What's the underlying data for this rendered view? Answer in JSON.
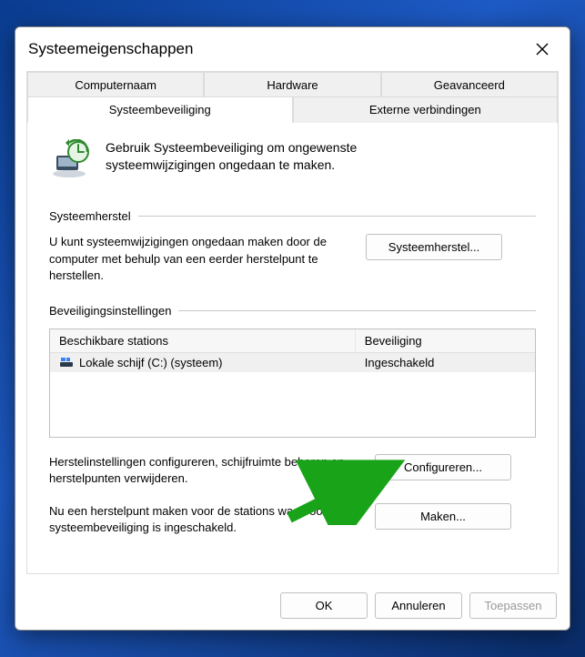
{
  "window": {
    "title": "Systeemeigenschappen"
  },
  "tabs": {
    "row1": {
      "computer_name": "Computernaam",
      "hardware": "Hardware",
      "advanced": "Geavanceerd"
    },
    "row2": {
      "system_protection": "Systeembeveiliging",
      "remote": "Externe verbindingen"
    }
  },
  "intro": "Gebruik Systeembeveiliging om ongewenste systeemwijzigingen ongedaan te maken.",
  "restore": {
    "legend": "Systeemherstel",
    "text": "U kunt systeemwijzigingen ongedaan maken door de computer met behulp van een eerder herstelpunt te herstellen.",
    "button": "Systeemherstel..."
  },
  "settings": {
    "legend": "Beveiligingsinstellingen",
    "col_a": "Beschikbare stations",
    "col_b": "Beveiliging",
    "drive_name": "Lokale schijf (C:) (systeem)",
    "drive_status": "Ingeschakeld",
    "configure_text": "Herstelinstellingen configureren, schijfruimte beheren en herstelpunten verwijderen.",
    "configure_btn": "Configureren...",
    "create_text": "Nu een herstelpunt maken voor de stations waarvoor systeembeveiliging is ingeschakeld.",
    "create_btn": "Maken..."
  },
  "buttons": {
    "ok": "OK",
    "cancel": "Annuleren",
    "apply": "Toepassen"
  }
}
